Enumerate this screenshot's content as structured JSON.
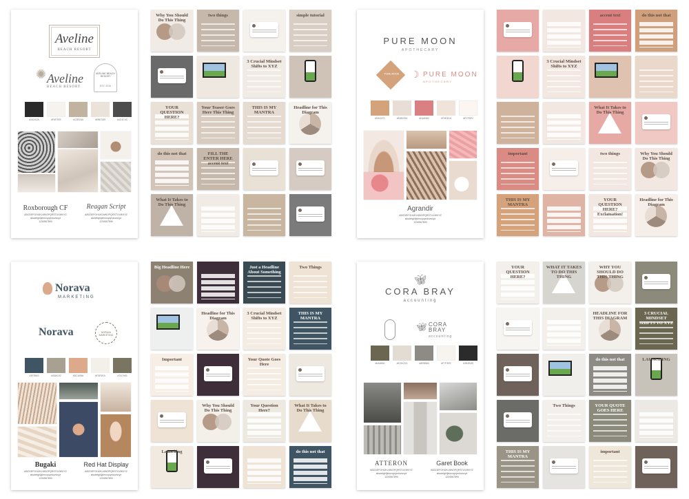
{
  "boards": [
    {
      "id": "aveline",
      "logo_line1": "Aveline",
      "logo_line2": "BEACH RESORT",
      "mark_text": "AVELINE BEACH RESORT",
      "mark_sub": "EST. 2016",
      "swatches": [
        {
          "color": "#2a2a2a",
          "hex": "#2A2A2A"
        },
        {
          "color": "#f6f2ee",
          "hex": "#F6F2EE"
        },
        {
          "color": "#c2b2a0",
          "hex": "#C2B2A0"
        },
        {
          "color": "#ebe3d9",
          "hex": "#EBE3D9"
        },
        {
          "color": "#4c4c4c",
          "hex": "#4C4C4C"
        }
      ],
      "font1": "Roxborough CF",
      "font2": "Reagan Script",
      "alphabet": "ABCDEFGHIJKLMNOPQRSTUVWXYZ",
      "alphabet_lower": "abcdefghijklmnopqrstuvwxyz",
      "numbers": "1234567890",
      "tiles": [
        {
          "kind": "venn",
          "bg": "#f1ebe5",
          "text": "Why You Should Do This Thing"
        },
        {
          "kind": "text",
          "bg": "#c7b8ac",
          "text": "two things"
        },
        {
          "kind": "card",
          "bg": "#f5f1ec",
          "text": ""
        },
        {
          "kind": "text",
          "bg": "#d9cec4",
          "text": "simple tutorial"
        },
        {
          "kind": "card",
          "bg": "#6a6a6a",
          "text": ""
        },
        {
          "kind": "laptop",
          "bg": "#efe8e1",
          "text": ""
        },
        {
          "kind": "text",
          "bg": "#f1ebe5",
          "text": "3 Crucial Mindset Shifts to XYZ"
        },
        {
          "kind": "phone",
          "bg": "#cfc3b7",
          "text": ""
        },
        {
          "kind": "checks",
          "bg": "#e9e0d6",
          "text": "YOUR QUESTION HERE?"
        },
        {
          "kind": "text",
          "bg": "#d8cbbf",
          "text": "Your Teaser Goes Here This Thing"
        },
        {
          "kind": "text",
          "bg": "#e5dbd1",
          "text": "THIS IS MY MANTRA"
        },
        {
          "kind": "circle",
          "bg": "#f5f1ec",
          "text": "Headline for This Diagram"
        },
        {
          "kind": "checks",
          "bg": "#d2c4b6",
          "text": "do this  not that"
        },
        {
          "kind": "text",
          "bg": "#c7b8ac",
          "text": "FILL THE ENTER HERE accent text"
        },
        {
          "kind": "card",
          "bg": "#e9e0d6",
          "text": ""
        },
        {
          "kind": "card",
          "bg": "#d5cbc2",
          "text": ""
        },
        {
          "kind": "tri",
          "bg": "#bfb2a6",
          "text": "What It Takes to Do This Thing"
        },
        {
          "kind": "checks",
          "bg": "#f1ebe5",
          "text": ""
        },
        {
          "kind": "text",
          "bg": "#c9b6a1",
          "text": ""
        },
        {
          "kind": "card",
          "bg": "#7b7b7b",
          "text": ""
        }
      ]
    },
    {
      "id": "puremoon",
      "logo_line1": "PURE MOON",
      "logo_line2": "APOTHECARY",
      "mark_text": "PURE MOON",
      "mark_sub": "PURE MOON",
      "swatches": [
        {
          "color": "#d4a37c",
          "hex": "#D4A37C"
        },
        {
          "color": "#e8ded6",
          "hex": "#E8DED6"
        },
        {
          "color": "#da8082",
          "hex": "#DA8082"
        },
        {
          "color": "#f0e3da",
          "hex": "#F0E3DA"
        },
        {
          "color": "#fcf6f2",
          "hex": "#FCF6F2"
        }
      ],
      "font1": "Agrandir",
      "font2": "",
      "alphabet": "ABCDEFGHIJKLMNOPQRSTUVWXYZ",
      "alphabet_lower": "abcdefghijklmnopqrstuvwxyz",
      "numbers": "1234567890",
      "tiles": [
        {
          "kind": "card",
          "bg": "#e7a9a5",
          "text": ""
        },
        {
          "kind": "checks",
          "bg": "#f3e8e1",
          "text": ""
        },
        {
          "kind": "text",
          "bg": "#d97f7f",
          "text": "accent text"
        },
        {
          "kind": "checks",
          "bg": "#d0a07c",
          "text": "do this  not that"
        },
        {
          "kind": "phone",
          "bg": "#f2d6d0",
          "text": ""
        },
        {
          "kind": "text",
          "bg": "#f3e8e1",
          "text": "3 Crucial Mindset Shifts to XYZ"
        },
        {
          "kind": "laptop",
          "bg": "#e0c2b0",
          "text": ""
        },
        {
          "kind": "text",
          "bg": "#ead8cb",
          "text": ""
        },
        {
          "kind": "text",
          "bg": "#cfb29c",
          "text": ""
        },
        {
          "kind": "checks",
          "bg": "#f3e8e1",
          "text": ""
        },
        {
          "kind": "tri",
          "bg": "#e6a9a4",
          "text": "What It Takes to Do This Thing"
        },
        {
          "kind": "card",
          "bg": "#f0c8c4",
          "text": ""
        },
        {
          "kind": "text",
          "bg": "#d98b84",
          "text": "important"
        },
        {
          "kind": "card",
          "bg": "#f6eee8",
          "text": ""
        },
        {
          "kind": "text",
          "bg": "#f3e8e1",
          "text": "two things"
        },
        {
          "kind": "venn",
          "bg": "#f3e8e1",
          "text": "Why You Should Do This Thing"
        },
        {
          "kind": "text",
          "bg": "#d4a37c",
          "text": "THIS IS MY MANTRA"
        },
        {
          "kind": "checks",
          "bg": "#e0b4a5",
          "text": ""
        },
        {
          "kind": "checks",
          "bg": "#f3e8e1",
          "text": "YOUR QUESTION HERE? Exclamation!"
        },
        {
          "kind": "circle",
          "bg": "#f6eee8",
          "text": "Headline for This Diagram"
        }
      ]
    },
    {
      "id": "norava",
      "logo_line1": "Norava",
      "logo_line2": "MARKETING",
      "mark_text": "Norava",
      "mark_sub": "NORAVA MARKETING",
      "swatches": [
        {
          "color": "#3f5563",
          "hex": "#3F5563"
        },
        {
          "color": "#a8a192",
          "hex": "#A8A192"
        },
        {
          "color": "#dca98a",
          "hex": "#DCA98A"
        },
        {
          "color": "#f3f0ea",
          "hex": "#F3F0EA"
        },
        {
          "color": "#7a7463",
          "hex": "#7A7463"
        }
      ],
      "font1": "Bugaki",
      "font2": "Red Hat Display",
      "alphabet": "ABCDEFGHIJKLMNOPQRSTUVWXYZ",
      "alphabet_lower": "abcdefghijklmnopqrstuvwxyz",
      "numbers": "1234567890",
      "tiles": [
        {
          "kind": "venn",
          "bg": "#8d8272",
          "text": "Big Headline Here"
        },
        {
          "kind": "checks",
          "bg": "#3d2e3a",
          "text": ""
        },
        {
          "kind": "text",
          "bg": "#3a4a52",
          "text": "Just a Headline About Something"
        },
        {
          "kind": "text",
          "bg": "#efe3d6",
          "text": "Two Things"
        },
        {
          "kind": "laptop",
          "bg": "#eef0ef",
          "text": ""
        },
        {
          "kind": "circle",
          "bg": "#f7f2ed",
          "text": "Headline for This Diagram"
        },
        {
          "kind": "text",
          "bg": "#f5ede4",
          "text": "3 Crucial Mindset Shifts to XYZ"
        },
        {
          "kind": "text",
          "bg": "#3f5563",
          "text": "THIS IS MY MANTRA"
        },
        {
          "kind": "checks",
          "bg": "#f7efe6",
          "text": "Important"
        },
        {
          "kind": "card",
          "bg": "#3d2e3a",
          "text": ""
        },
        {
          "kind": "text",
          "bg": "#f5ede4",
          "text": "Your Quote Goes Here"
        },
        {
          "kind": "card",
          "bg": "#eee9e0",
          "text": ""
        },
        {
          "kind": "card",
          "bg": "#efe3d6",
          "text": ""
        },
        {
          "kind": "venn",
          "bg": "#f3f0ea",
          "text": "Why You Should Do This Thing"
        },
        {
          "kind": "checks",
          "bg": "#eee9e0",
          "text": "Your Question Here?"
        },
        {
          "kind": "tri",
          "bg": "#e7dccc",
          "text": "What It Takes to Do This Thing"
        },
        {
          "kind": "phone",
          "bg": "#f1eae0",
          "text": "Launching"
        },
        {
          "kind": "card",
          "bg": "#3d2e3a",
          "text": ""
        },
        {
          "kind": "checks",
          "bg": "#efe3d6",
          "text": ""
        },
        {
          "kind": "checks",
          "bg": "#3f5563",
          "text": "do this  not that"
        }
      ]
    },
    {
      "id": "corabray",
      "logo_line1": "CORA BRAY",
      "logo_line2": "accounting",
      "mark_text": "CORA BRAY",
      "mark_sub": "accounting",
      "swatches": [
        {
          "color": "#6a6650",
          "hex": "#6A6650"
        },
        {
          "color": "#e2dcd3",
          "hex": "#E2DCD3"
        },
        {
          "color": "#8e8b84",
          "hex": "#8E8B84"
        },
        {
          "color": "#f7f3ee",
          "hex": "#F7F3EE"
        },
        {
          "color": "#2b2b2b",
          "hex": "#2B2B2B"
        }
      ],
      "font1": "ATTERON",
      "font2": "Garet Book",
      "alphabet": "ABCDEFGHIJKLMNOPQRSTUVWXYZ",
      "alphabet_lower": "abcdefghijklmnopqrstuvwxyz",
      "numbers": "1234567890",
      "tiles": [
        {
          "kind": "checks",
          "bg": "#f3f0ec",
          "text": "YOUR QUESTION HERE?"
        },
        {
          "kind": "tri",
          "bg": "#d7d5d0",
          "text": "WHAT IT TAKES TO DO THIS THING"
        },
        {
          "kind": "venn",
          "bg": "#f3f0ec",
          "text": "WHY YOU SHOULD DO THIS THING"
        },
        {
          "kind": "card",
          "bg": "#8b8a7b",
          "text": ""
        },
        {
          "kind": "card",
          "bg": "#f7f5f2",
          "text": ""
        },
        {
          "kind": "checks",
          "bg": "#f3f0ec",
          "text": ""
        },
        {
          "kind": "circle",
          "bg": "#f3f0ec",
          "text": "HEADLINE FOR THIS DIAGRAM"
        },
        {
          "kind": "text",
          "bg": "#6a6650",
          "text": "3 CRUCIAL MINDSET SHIFTS TO XYZ"
        },
        {
          "kind": "card",
          "bg": "#6e625a",
          "text": ""
        },
        {
          "kind": "laptop",
          "bg": "#f0efec",
          "text": ""
        },
        {
          "kind": "checks",
          "bg": "#8e8b84",
          "text": "do this  not that"
        },
        {
          "kind": "phone",
          "bg": "#c7c3bb",
          "text": "LAUNCHING"
        },
        {
          "kind": "card",
          "bg": "#6b6b68",
          "text": ""
        },
        {
          "kind": "text",
          "bg": "#f3f0ec",
          "text": "Two Things"
        },
        {
          "kind": "text",
          "bg": "#8b8a7b",
          "text": "YOUR QUOTE GOES HERE"
        },
        {
          "kind": "checks",
          "bg": "#ece9e4",
          "text": ""
        },
        {
          "kind": "text",
          "bg": "#9a9487",
          "text": "THIS IS MY MANTRA"
        },
        {
          "kind": "card",
          "bg": "#e6e4e0",
          "text": ""
        },
        {
          "kind": "text",
          "bg": "#efe7da",
          "text": "important"
        },
        {
          "kind": "card",
          "bg": "#6e625a",
          "text": ""
        }
      ]
    }
  ]
}
